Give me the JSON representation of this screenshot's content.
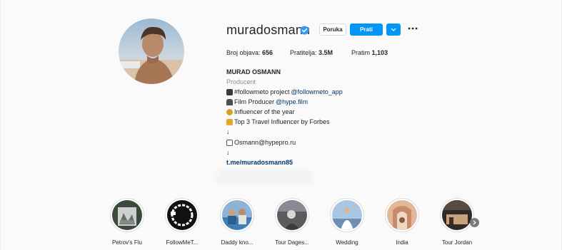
{
  "profile": {
    "username": "muradosmann",
    "message_label": "Poruka",
    "follow_label": "Prati",
    "stats": {
      "posts_label": "Broj objava:",
      "posts_value": "656",
      "followers_label": "Pratitelja:",
      "followers_value": "3.5M",
      "following_label": "Pratim",
      "following_value": "1,103"
    },
    "name": "MURAD OSMANN",
    "category": "Producent",
    "bio": {
      "line1_text": "#followmeto project ",
      "line1_link": "@followmeto_app",
      "line2_text": "Film Producer ",
      "line2_link": "@hype.film",
      "line3_text": "Influencer of the year",
      "line4_text": "Top 3 Travel Influencer by Forbes",
      "arrow1": "↓",
      "line5_text": "Osmann@hypepro.ru",
      "arrow2": "↓",
      "url": "t.me/muradosmann85"
    },
    "icons": {
      "verified": "verified-badge-icon",
      "more": "more-options-icon",
      "dropdown": "chevron-down-icon"
    },
    "colors": {
      "accent": "#0095f6",
      "link": "#00376b",
      "muted": "#8e8e8e"
    }
  },
  "highlights": [
    {
      "label": "Petrov's Flu"
    },
    {
      "label": "FollowMeT..."
    },
    {
      "label": "Daddy kno..."
    },
    {
      "label": "Tour Dages..."
    },
    {
      "label": "Wedding"
    },
    {
      "label": "India"
    },
    {
      "label": "Tour Jordan"
    }
  ]
}
